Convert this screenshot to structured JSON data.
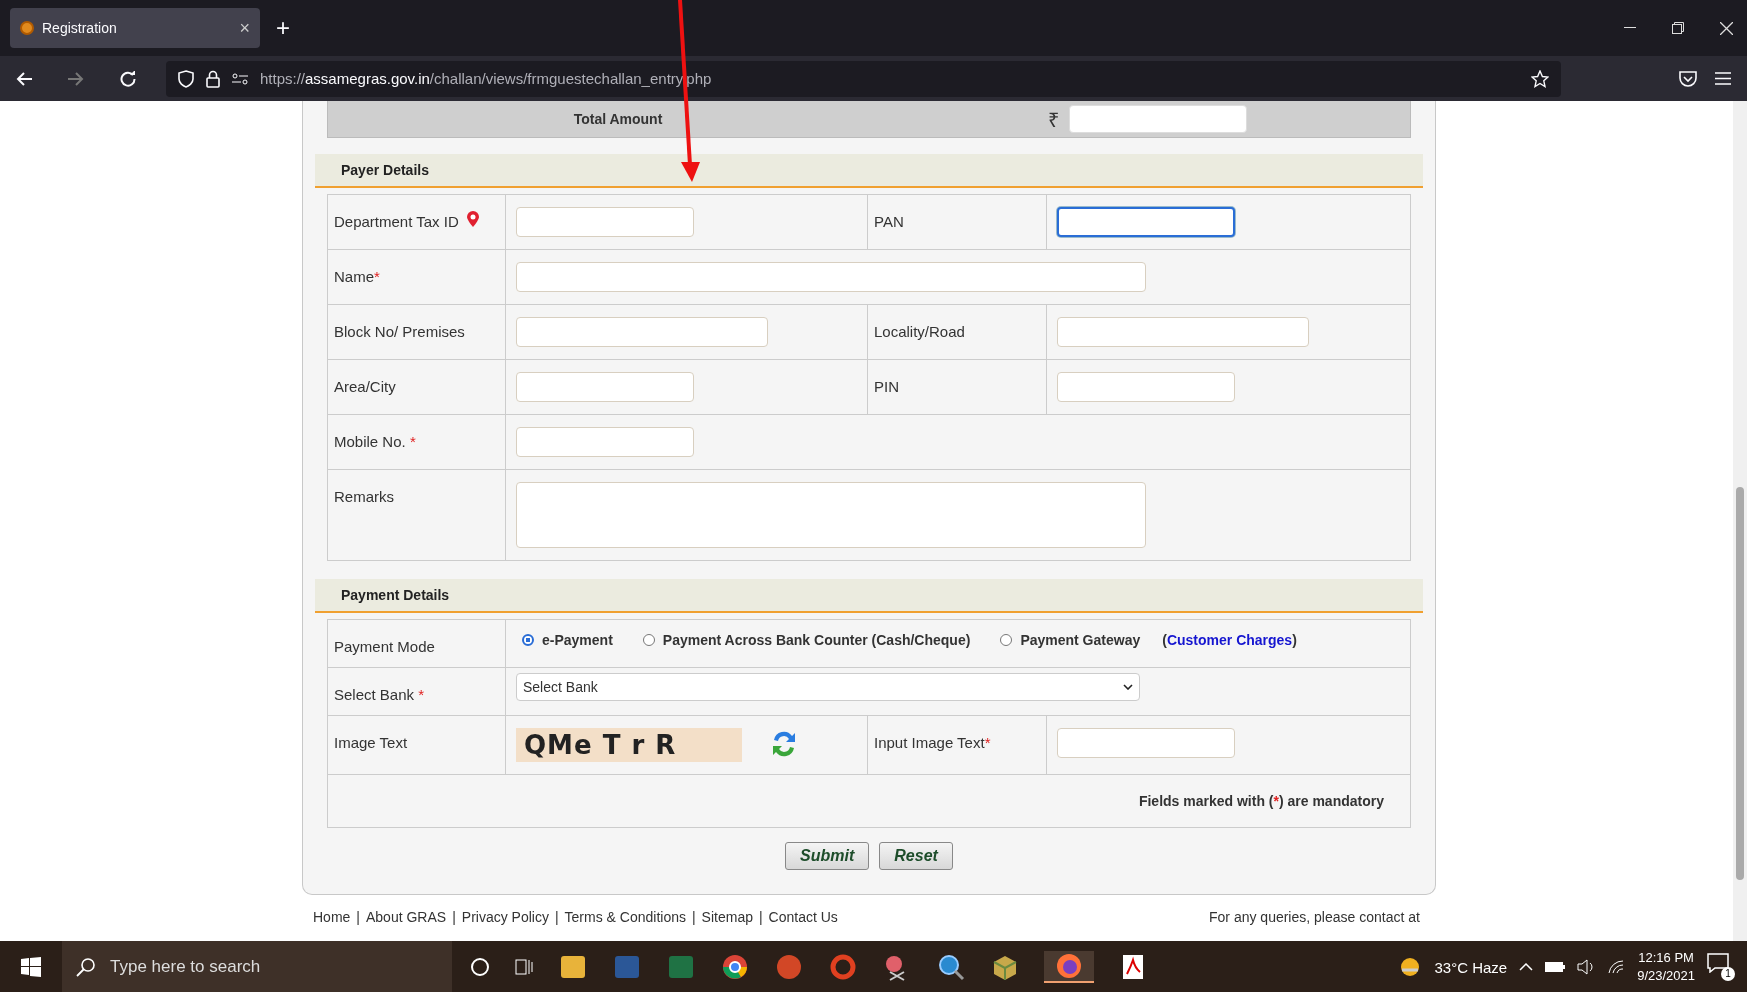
{
  "browser": {
    "tab_title": "Registration",
    "close_glyph": "×",
    "new_tab_glyph": "+",
    "url": {
      "scheme": "https://",
      "host": "assamegras.gov.in",
      "path": "/challan/views/frmguestechallan_entry.php"
    }
  },
  "total": {
    "label": "Total Amount",
    "currency": "₹"
  },
  "required_mark": "*",
  "payer": {
    "title": "Payer Details",
    "rows": [
      [
        {
          "label": "Department Tax ID",
          "required": false,
          "help_icon": true,
          "field": {
            "kind": "short",
            "focused": false
          }
        },
        {
          "label": "PAN",
          "required": false,
          "help_icon": false,
          "field": {
            "kind": "short",
            "focused": true
          }
        }
      ],
      [
        {
          "label": "Name",
          "required": true,
          "help_icon": false,
          "field": {
            "kind": "long",
            "focused": false
          }
        }
      ],
      [
        {
          "label": "Block No/ Premises",
          "required": false,
          "help_icon": false,
          "field": {
            "kind": "medium",
            "focused": false
          }
        },
        {
          "label": "Locality/Road",
          "required": false,
          "help_icon": false,
          "field": {
            "kind": "medium",
            "focused": false
          }
        }
      ],
      [
        {
          "label": "Area/City",
          "required": false,
          "help_icon": false,
          "field": {
            "kind": "short",
            "focused": false
          }
        },
        {
          "label": "PIN",
          "required": false,
          "help_icon": false,
          "field": {
            "kind": "short",
            "focused": false
          }
        }
      ],
      [
        {
          "label": "Mobile No. ",
          "required": true,
          "help_icon": false,
          "field": {
            "kind": "short",
            "focused": false
          }
        }
      ],
      [
        {
          "label": "Remarks",
          "required": false,
          "help_icon": false,
          "field": {
            "kind": "textarea",
            "focused": false
          }
        }
      ]
    ]
  },
  "payment": {
    "title": "Payment Details",
    "rows": [
      {
        "kind": "radios",
        "label": "Payment Mode",
        "required": false,
        "options": [
          {
            "label": "e-Payment",
            "selected": true
          },
          {
            "label": "Payment Across Bank Counter (Cash/Cheque)",
            "selected": false
          },
          {
            "label": "Payment Gateway",
            "selected": false
          }
        ],
        "link": {
          "open": "(",
          "text": "Customer Charges",
          "close": ")"
        }
      },
      {
        "kind": "select",
        "label": "Select Bank ",
        "required": true,
        "value": "Select Bank"
      },
      {
        "kind": "captcha",
        "label": "Image Text",
        "required": false,
        "captcha_text": "QMe T r R",
        "input_label": "Input Image Text",
        "input_required": true
      }
    ],
    "note": {
      "before": "Fields marked with (",
      "after": ") are mandatory"
    }
  },
  "buttons": [
    "Submit",
    "Reset"
  ],
  "footer": {
    "separator": "|",
    "links": [
      "Home",
      "About GRAS",
      "Privacy Policy",
      "Terms & Conditions",
      "Sitemap",
      "Contact Us"
    ],
    "contact": "For any queries, please contact at"
  },
  "taskbar": {
    "search_placeholder": "Type here to search",
    "weather": "33°C Haze",
    "time": "12:16 PM",
    "date": "9/23/2021",
    "notification_count": "1"
  }
}
